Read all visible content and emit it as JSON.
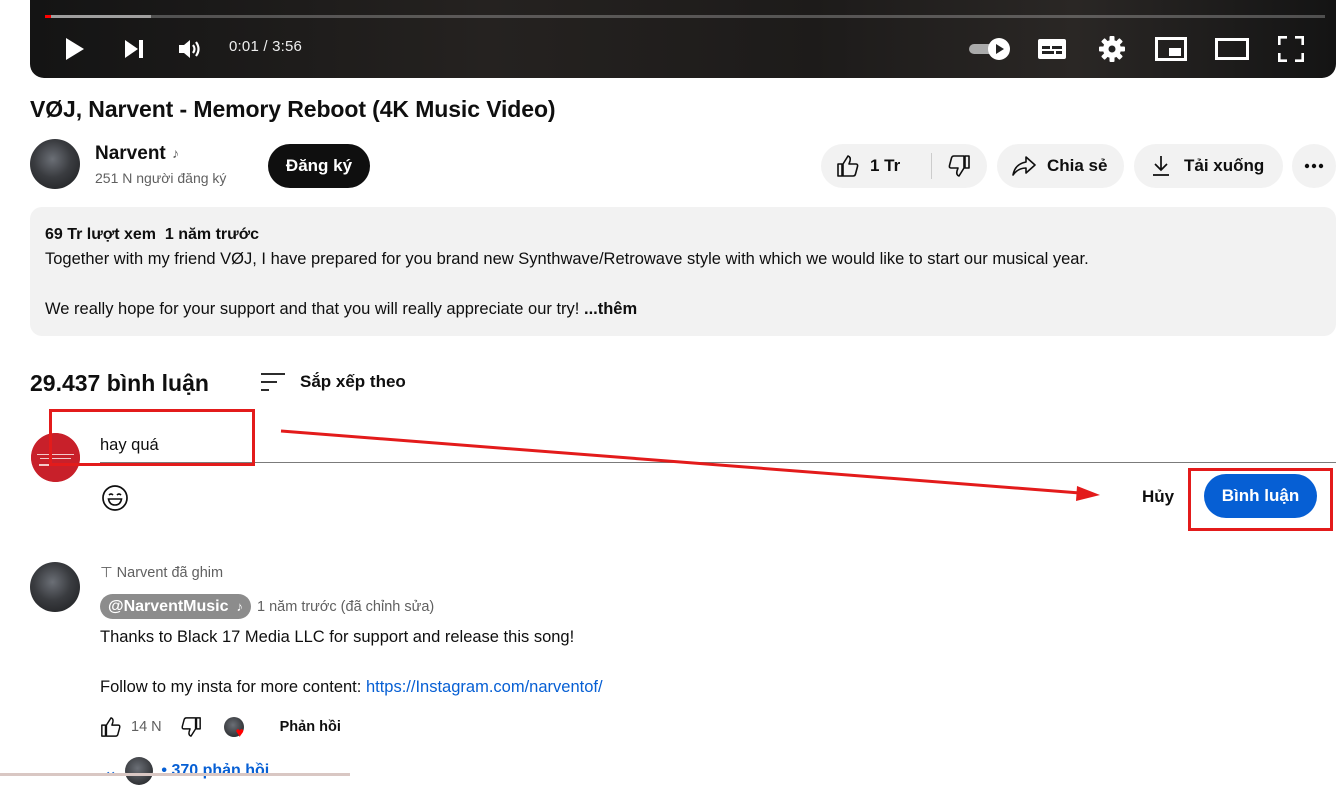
{
  "player": {
    "time": "0:01 / 3:56",
    "progress_played_fraction": 0.005,
    "progress_buffer_fraction": 0.083
  },
  "video": {
    "title": "VØJ, Narvent - Memory Reboot (4K Music Video)"
  },
  "channel": {
    "name": "Narvent",
    "subscribers": "251 N người đăng ký",
    "subscribe_label": "Đăng ký"
  },
  "actions": {
    "like_count": "1 Tr",
    "share_label": "Chia sẻ",
    "download_label": "Tải xuống"
  },
  "description": {
    "views": "69 Tr lượt xem",
    "date": "1 năm trước",
    "line1": "Together with my friend VØJ, I have prepared for you brand new Synthwave/Retrowave style with which we would like to start our musical year.",
    "line2": "We really hope for your support and that you will really appreciate our try!",
    "more": "...thêm"
  },
  "comments": {
    "count_label": "29.437 bình luận",
    "sort_label": "Sắp xếp theo",
    "input_value": "hay quá",
    "cancel_label": "Hủy",
    "submit_label": "Bình luận",
    "my_avatar_text": "ŨDesk.vn"
  },
  "pinned_comment": {
    "pinned_label": "Narvent đã ghim",
    "author": "@NarventMusic",
    "meta": "1 năm trước (đã chỉnh sửa)",
    "text_line1": "Thanks to Black 17 Media LLC for support and release this song!",
    "text_line2_prefix": "Follow to my insta for more content: ",
    "link": "https://Instagram.com/narventof/",
    "like_count": "14 N",
    "reply_label": "Phản hồi",
    "replies_label": "370 phản hồi"
  },
  "colors": {
    "accent_blue": "#065fd4",
    "annotation_red": "#e31b1b",
    "progress_red": "#ff0000"
  }
}
